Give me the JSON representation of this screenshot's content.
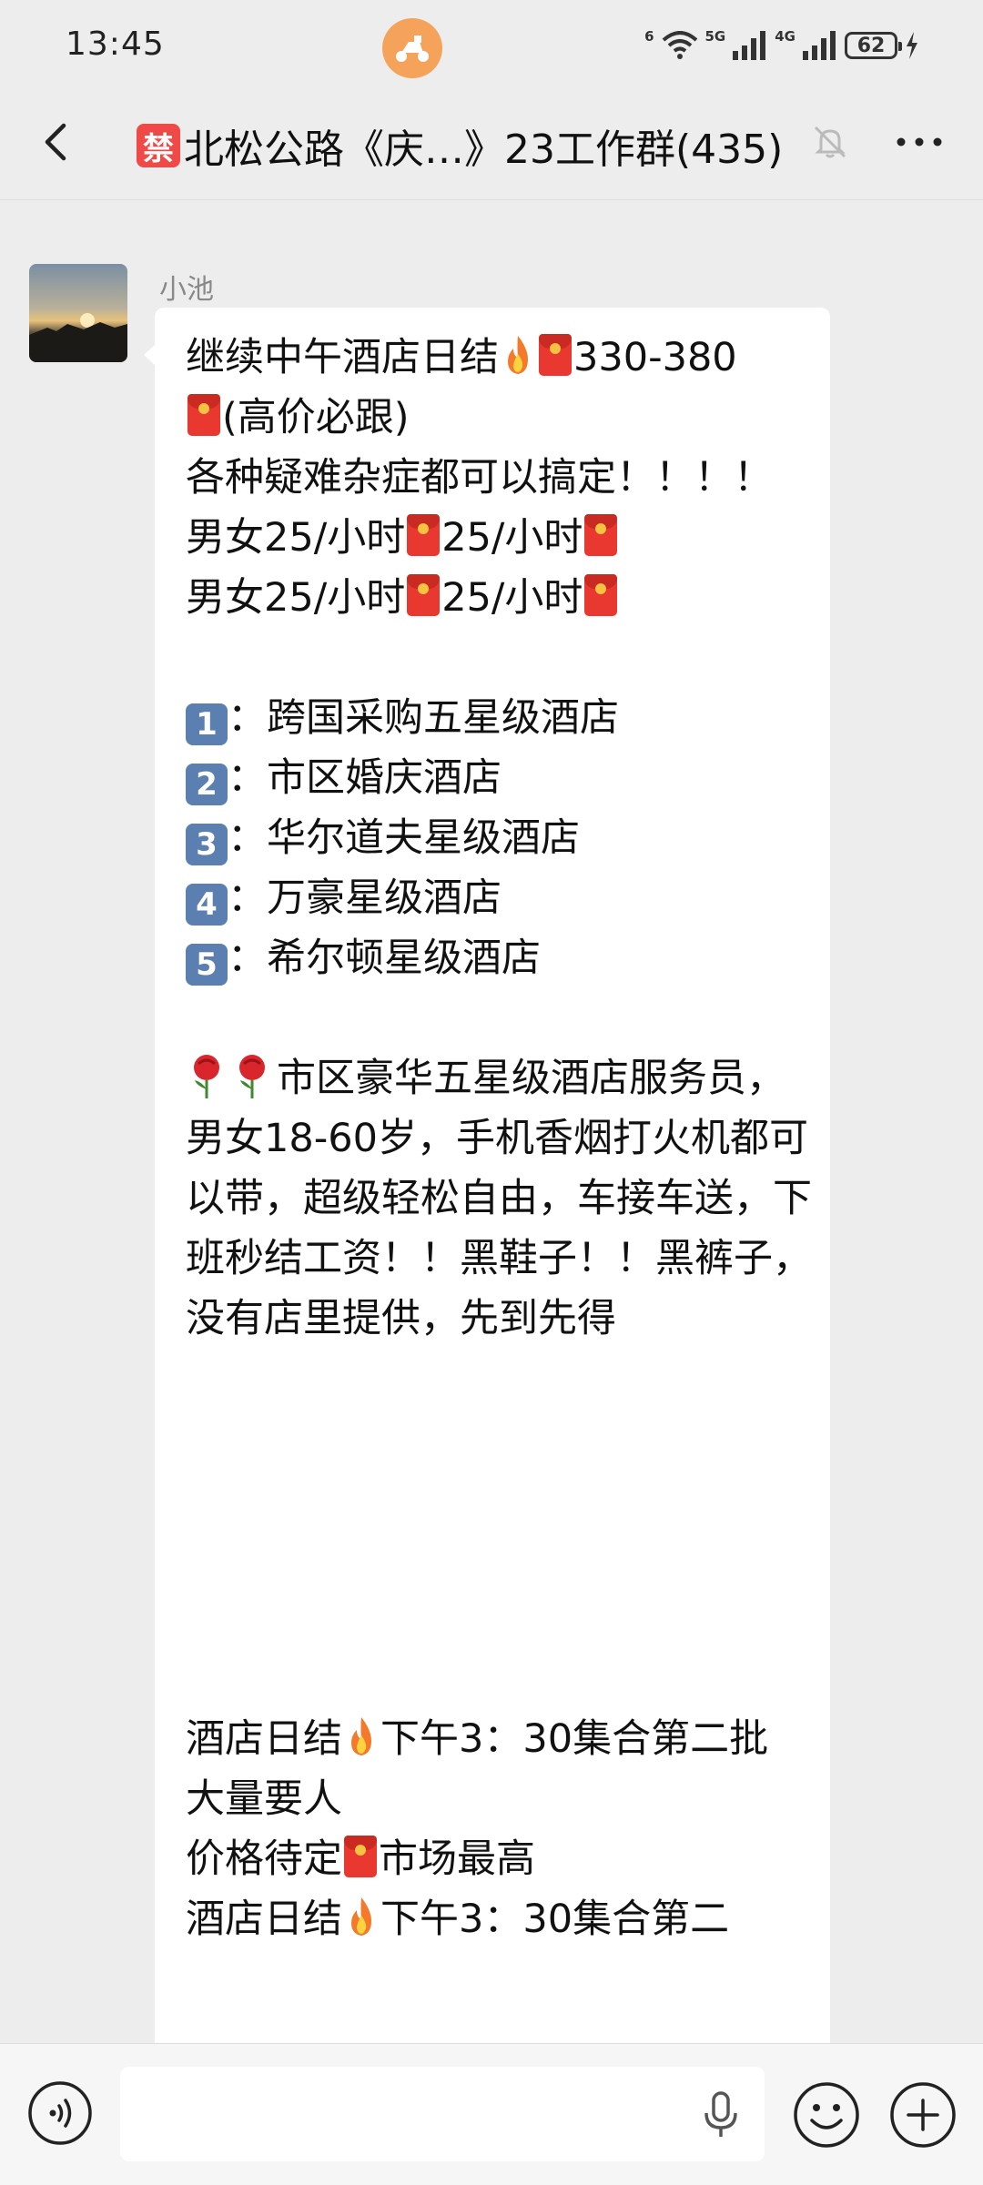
{
  "status_bar": {
    "time": "13:45",
    "network_wifi": "6",
    "network_1": "5G",
    "network_2": "4G",
    "battery": "62"
  },
  "header": {
    "badge": "禁",
    "title": "北松公路《庆…》23工作群(435)"
  },
  "message": {
    "sender": "小池",
    "lines": [
      "继续中午酒店日结",
      "330-380",
      "(高价必跟)",
      "各种疑难杂症都可以搞定！！！！",
      "男女25/小时",
      "25/小时",
      "男女25/小时",
      "25/小时",
      "：跨国采购五星级酒店",
      "：市区婚庆酒店",
      "：华尔道夫星级酒店",
      "：万豪星级酒店",
      "：希尔顿星级酒店",
      "市区豪华五星级酒店服务员，男女18-60岁，手机香烟打火机都可以带，超级轻松自由，车接车送，下班秒结工资！！黑鞋子！！黑裤子，没有店里提供，先到先得",
      "酒店日结",
      "下午3：30集合第二批 大量要人",
      "价格待定",
      "市场最高",
      "酒店日结",
      "下午3：30集合第二"
    ],
    "keycaps": [
      "1",
      "2",
      "3",
      "4",
      "5"
    ]
  }
}
